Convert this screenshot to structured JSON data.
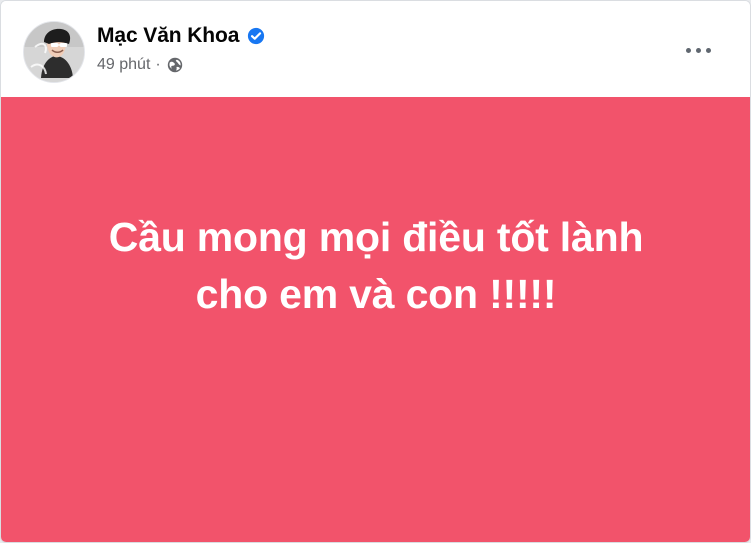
{
  "post": {
    "author": {
      "name": "Mạc Văn Khoa",
      "verified_icon": "verified-badge-icon",
      "avatar_icon": "profile-avatar-icon"
    },
    "meta": {
      "time": "49 phút",
      "separator": "·",
      "audience_icon": "globe-icon"
    },
    "actions": {
      "more_icon": "more-options-icon"
    },
    "status": {
      "text": "Cầu mong mọi điều tốt lành\ncho em và con !!!!!",
      "background_color": "#f2536b",
      "text_color": "#ffffff"
    }
  },
  "colors": {
    "verified": "#1877f2",
    "meta": "#65676b",
    "name": "#050505",
    "card": "#ffffff"
  }
}
